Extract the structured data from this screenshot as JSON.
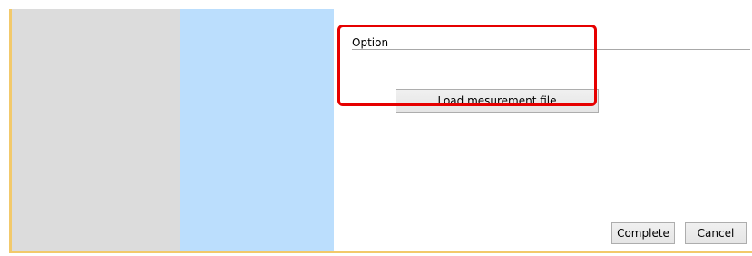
{
  "option_group": {
    "label": "Option",
    "load_button_label": "Load mesurement file"
  },
  "footer": {
    "complete_label": "Complete",
    "cancel_label": "Cancel"
  },
  "colors": {
    "left_panel": "#dcdcdc",
    "middle_panel": "#bbdefd",
    "frame": "#f2c96b",
    "highlight": "#e60000"
  }
}
